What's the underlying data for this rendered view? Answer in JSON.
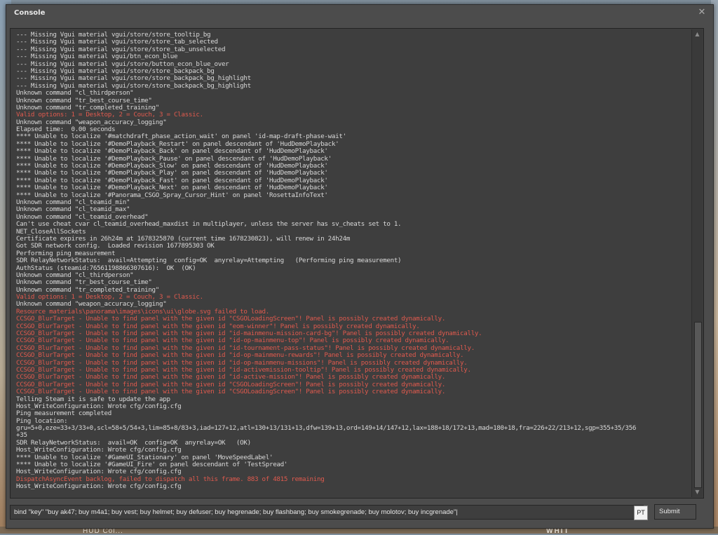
{
  "window": {
    "title": "Console"
  },
  "console": {
    "lines": [
      {
        "text": "--- Missing Vgui material vgui/store/store_tooltip_bg",
        "kind": "normal"
      },
      {
        "text": "--- Missing Vgui material vgui/store/store_tab_selected",
        "kind": "normal"
      },
      {
        "text": "--- Missing Vgui material vgui/store/store_tab_unselected",
        "kind": "normal"
      },
      {
        "text": "--- Missing Vgui material vgui/btn_econ_blue",
        "kind": "normal"
      },
      {
        "text": "--- Missing Vgui material vgui/store/button_econ_blue_over",
        "kind": "normal"
      },
      {
        "text": "--- Missing Vgui material vgui/store/store_backpack_bg",
        "kind": "normal"
      },
      {
        "text": "--- Missing Vgui material vgui/store/store_backpack_bg_highlight",
        "kind": "normal"
      },
      {
        "text": "--- Missing Vgui material vgui/store/store_backpack_bg_highlight",
        "kind": "normal"
      },
      {
        "text": "Unknown command \"cl_thirdperson\"",
        "kind": "normal"
      },
      {
        "text": "Unknown command \"tr_best_course_time\"",
        "kind": "normal"
      },
      {
        "text": "Unknown command \"tr_completed_training\"",
        "kind": "normal"
      },
      {
        "text": "Valid options: 1 = Desktop, 2 = Couch, 3 = Classic.",
        "kind": "error"
      },
      {
        "text": "Unknown command \"weapon_accuracy_logging\"",
        "kind": "normal"
      },
      {
        "text": "Elapsed time:  0.00 seconds",
        "kind": "normal"
      },
      {
        "text": "**** Unable to localize '#matchdraft_phase_action_wait' on panel 'id-map-draft-phase-wait'",
        "kind": "normal"
      },
      {
        "text": "**** Unable to localize '#DemoPlayback_Restart' on panel descendant of 'HudDemoPlayback'",
        "kind": "normal"
      },
      {
        "text": "**** Unable to localize '#DemoPlayback_Back' on panel descendant of 'HudDemoPlayback'",
        "kind": "normal"
      },
      {
        "text": "**** Unable to localize '#DemoPlayback_Pause' on panel descendant of 'HudDemoPlayback'",
        "kind": "normal"
      },
      {
        "text": "**** Unable to localize '#DemoPlayback_Slow' on panel descendant of 'HudDemoPlayback'",
        "kind": "normal"
      },
      {
        "text": "**** Unable to localize '#DemoPlayback_Play' on panel descendant of 'HudDemoPlayback'",
        "kind": "normal"
      },
      {
        "text": "**** Unable to localize '#DemoPlayback_Fast' on panel descendant of 'HudDemoPlayback'",
        "kind": "normal"
      },
      {
        "text": "**** Unable to localize '#DemoPlayback_Next' on panel descendant of 'HudDemoPlayback'",
        "kind": "normal"
      },
      {
        "text": "**** Unable to localize '#Panorama_CSGO_Spray_Cursor_Hint' on panel 'RosettaInfoText'",
        "kind": "normal"
      },
      {
        "text": "Unknown command \"cl_teamid_min\"",
        "kind": "normal"
      },
      {
        "text": "Unknown command \"cl_teamid_max\"",
        "kind": "normal"
      },
      {
        "text": "Unknown command \"cl_teamid_overhead\"",
        "kind": "normal"
      },
      {
        "text": "Can't use cheat cvar cl_teamid_overhead_maxdist in multiplayer, unless the server has sv_cheats set to 1.",
        "kind": "normal"
      },
      {
        "text": "NET_CloseAllSockets",
        "kind": "normal"
      },
      {
        "text": "Certificate expires in 26h24m at 1678325870 (current time 1678230823), will renew in 24h24m",
        "kind": "normal"
      },
      {
        "text": "Got SDR network config.  Loaded revision 1677895303 OK",
        "kind": "normal"
      },
      {
        "text": "Performing ping measurement",
        "kind": "normal"
      },
      {
        "text": "SDR RelayNetworkStatus:  avail=Attempting  config=OK  anyrelay=Attempting   (Performing ping measurement)",
        "kind": "normal"
      },
      {
        "text": "AuthStatus (steamid:76561198866307616):  OK  (OK)",
        "kind": "normal"
      },
      {
        "text": "Unknown command \"cl_thirdperson\"",
        "kind": "normal"
      },
      {
        "text": "Unknown command \"tr_best_course_time\"",
        "kind": "normal"
      },
      {
        "text": "Unknown command \"tr_completed_training\"",
        "kind": "normal"
      },
      {
        "text": "Valid options: 1 = Desktop, 2 = Couch, 3 = Classic.",
        "kind": "error"
      },
      {
        "text": "Unknown command \"weapon_accuracy_logging\"",
        "kind": "normal"
      },
      {
        "text": "Resource materials\\panorama\\images\\icons\\ui\\globe.svg failed to load.",
        "kind": "error"
      },
      {
        "text": "CCSGO_BlurTarget - Unable to find panel with the given id \"CSGOLoadingScreen\"! Panel is possibly created dynamically.",
        "kind": "error"
      },
      {
        "text": "CCSGO_BlurTarget - Unable to find panel with the given id \"eom-winner\"! Panel is possibly created dynamically.",
        "kind": "error"
      },
      {
        "text": "CCSGO_BlurTarget - Unable to find panel with the given id \"id-mainmenu-mission-card-bg\"! Panel is possibly created dynamically.",
        "kind": "error"
      },
      {
        "text": "CCSGO_BlurTarget - Unable to find panel with the given id \"id-op-mainmenu-top\"! Panel is possibly created dynamically.",
        "kind": "error"
      },
      {
        "text": "CCSGO_BlurTarget - Unable to find panel with the given id \"id-tournament-pass-status\"! Panel is possibly created dynamically.",
        "kind": "error"
      },
      {
        "text": "CCSGO_BlurTarget - Unable to find panel with the given id \"id-op-mainmenu-rewards\"! Panel is possibly created dynamically.",
        "kind": "error"
      },
      {
        "text": "CCSGO_BlurTarget - Unable to find panel with the given id \"id-op-mainmenu-missions\"! Panel is possibly created dynamically.",
        "kind": "error"
      },
      {
        "text": "CCSGO_BlurTarget - Unable to find panel with the given id \"id-activemission-tooltip\"! Panel is possibly created dynamically.",
        "kind": "error"
      },
      {
        "text": "CCSGO_BlurTarget - Unable to find panel with the given id \"id-active-mission\"! Panel is possibly created dynamically.",
        "kind": "error"
      },
      {
        "text": "CCSGO_BlurTarget - Unable to find panel with the given id \"CSGOLoadingScreen\"! Panel is possibly created dynamically.",
        "kind": "error"
      },
      {
        "text": "CCSGO_BlurTarget - Unable to find panel with the given id \"CSGOLoadingScreen\"! Panel is possibly created dynamically.",
        "kind": "error"
      },
      {
        "text": "Telling Steam it is safe to update the app",
        "kind": "normal"
      },
      {
        "text": "Host_WriteConfiguration: Wrote cfg/config.cfg",
        "kind": "normal"
      },
      {
        "text": "Ping measurement completed",
        "kind": "normal"
      },
      {
        "text": "Ping location:",
        "kind": "normal"
      },
      {
        "text": "gru=5+0,eze=33+3/33+0,scl=58+5/54+3,lim=85+8/83+3,iad=127+12,atl=130+13/131+13,dfw=139+13,ord=149+14/147+12,lax=188+18/172+13,mad=180+18,fra=226+22/213+12,sgp=355+35/356",
        "kind": "normal"
      },
      {
        "text": "+35",
        "kind": "normal"
      },
      {
        "text": "SDR RelayNetworkStatus:  avail=OK  config=OK  anyrelay=OK   (OK)",
        "kind": "normal"
      },
      {
        "text": "Host_WriteConfiguration: Wrote cfg/config.cfg",
        "kind": "normal"
      },
      {
        "text": "**** Unable to localize '#GameUI_Stationary' on panel 'MoveSpeedLabel'",
        "kind": "normal"
      },
      {
        "text": "**** Unable to localize '#GameUI_Fire' on panel descendant of 'TestSpread'",
        "kind": "normal"
      },
      {
        "text": "Host_WriteConfiguration: Wrote cfg/config.cfg",
        "kind": "normal"
      },
      {
        "text": "DispatchAsyncEvent backlog, failed to dispatch all this frame. 883 of 4815 remaining",
        "kind": "error"
      },
      {
        "text": "Host_WriteConfiguration: Wrote cfg/config.cfg",
        "kind": "normal"
      }
    ],
    "scroll_position": 1.0
  },
  "input": {
    "value": "bind \"key\" \"buy ak47; buy m4a1; buy vest; buy helmet; buy defuser; buy hegrenade; buy flashbang; buy smokegrenade; buy molotov; buy incgrenade\"|"
  },
  "ime_indicator": "PT",
  "submit_label": "Submit",
  "close_glyph": "✕",
  "scroll_up_glyph": "▲",
  "scroll_down_glyph": "▼",
  "background_hud": {
    "left_text": "HUD Col...",
    "right_text": "WHIT"
  },
  "colors": {
    "normal_text": "#d9d9d9",
    "error_text": "#e05a4e",
    "panel_bg": "#4c4c4c",
    "output_bg": "#3e3e3e"
  }
}
